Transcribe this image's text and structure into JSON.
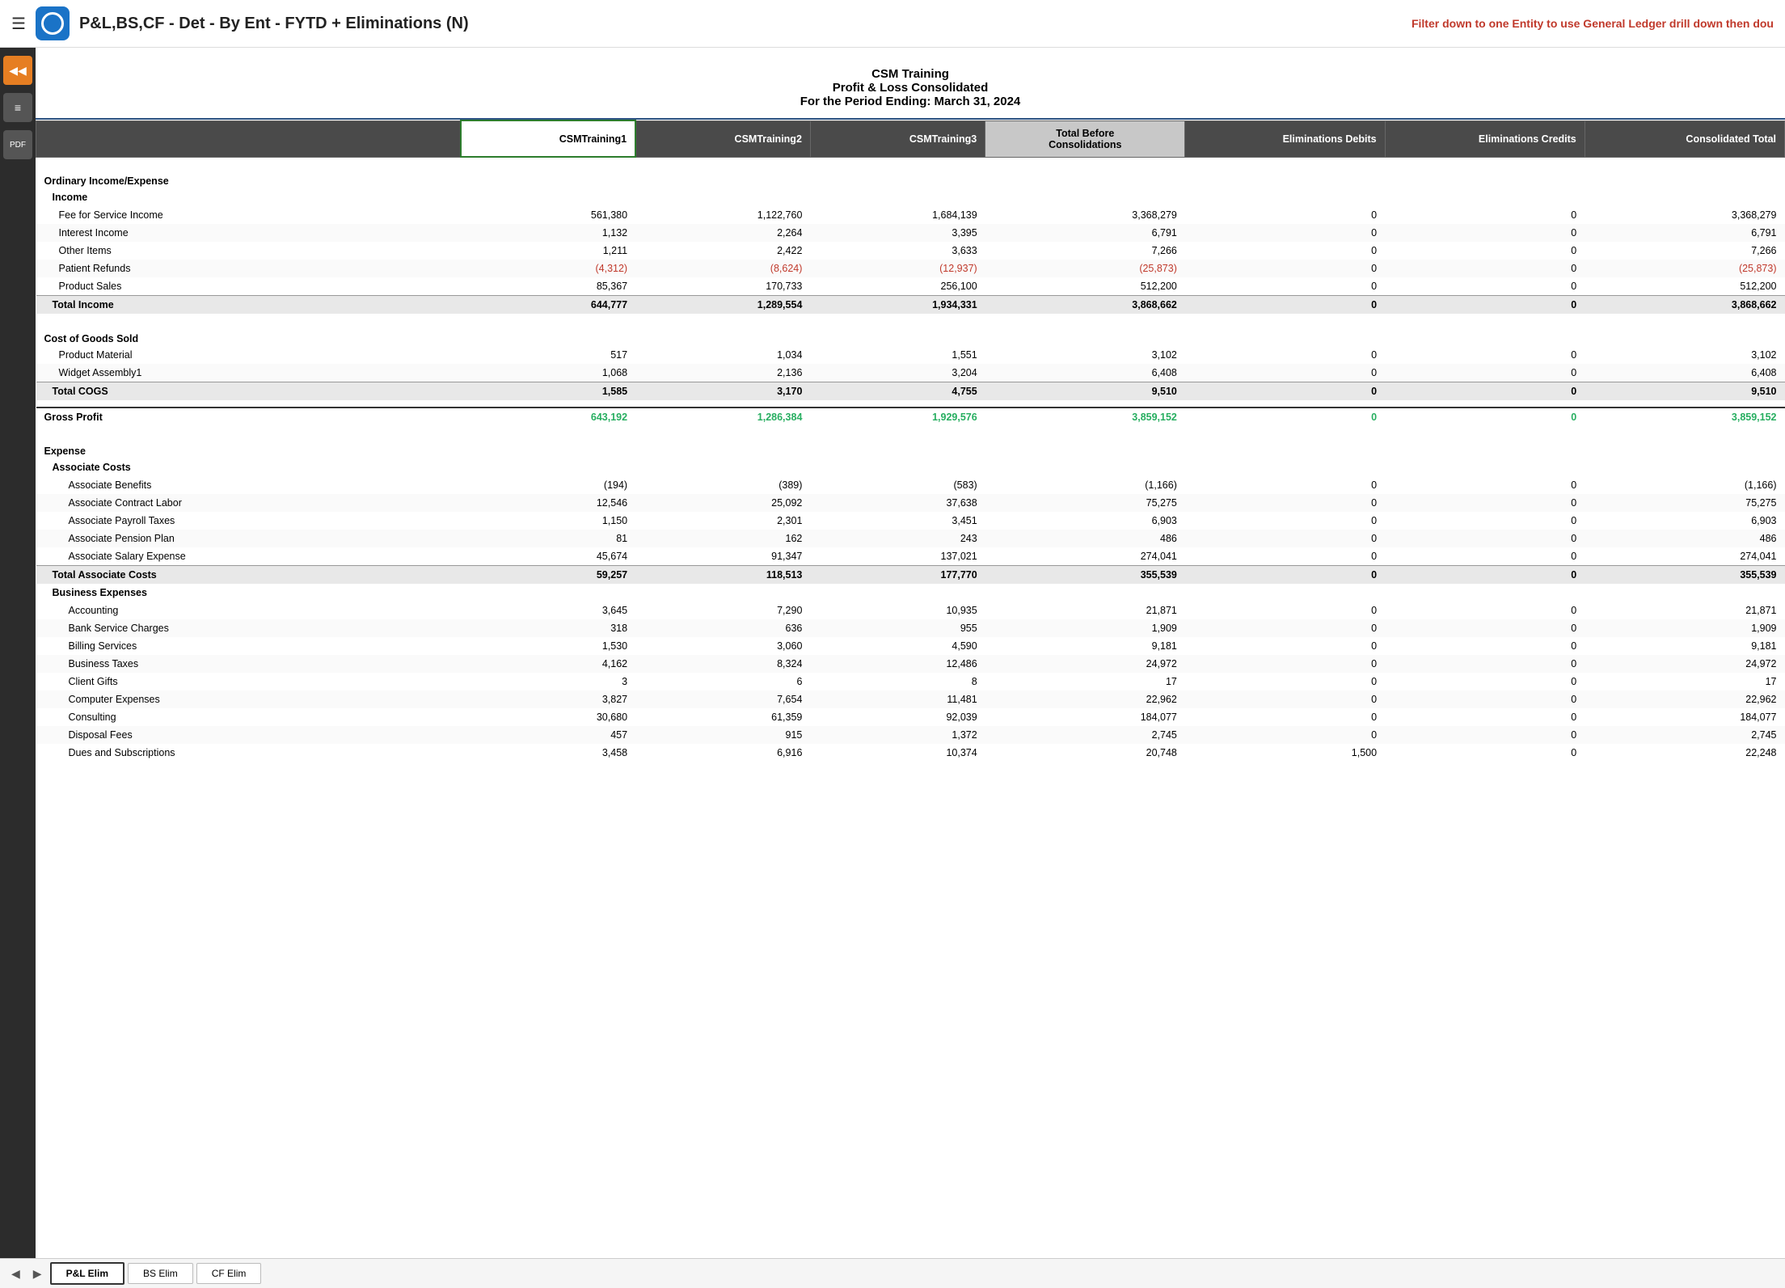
{
  "header": {
    "title": "P&L,BS,CF - Det - By Ent - FYTD + Eliminations (N)",
    "filter_text": "Filter down to one ",
    "filter_entity": "Entity",
    "filter_suffix": " to use General Ledger drill down then dou"
  },
  "report": {
    "company": "CSM Training",
    "title": "Profit & Loss Consolidated",
    "period": "For the Period Ending: March 31, 2024"
  },
  "columns": {
    "col1": "CSMTraining1",
    "col2": "CSMTraining2",
    "col3": "CSMTraining3",
    "col4": "Total Before\nConsolidations",
    "col5": "Eliminations Debits",
    "col6": "Eliminations Credits",
    "col7": "Consolidated Total"
  },
  "sections": {
    "ordinary": "Ordinary Income/Expense",
    "income": "Income",
    "income_rows": [
      {
        "label": "Fee for Service Income",
        "c1": "561,380",
        "c2": "1,122,760",
        "c3": "1,684,139",
        "c4": "3,368,279",
        "c5": "0",
        "c6": "0",
        "c7": "3,368,279",
        "color": "normal"
      },
      {
        "label": "Interest Income",
        "c1": "1,132",
        "c2": "2,264",
        "c3": "3,395",
        "c4": "6,791",
        "c5": "0",
        "c6": "0",
        "c7": "6,791",
        "color": "normal"
      },
      {
        "label": "Other Items",
        "c1": "1,211",
        "c2": "2,422",
        "c3": "3,633",
        "c4": "7,266",
        "c5": "0",
        "c6": "0",
        "c7": "7,266",
        "color": "normal"
      },
      {
        "label": "Patient Refunds",
        "c1": "(4,312)",
        "c2": "(8,624)",
        "c3": "(12,937)",
        "c4": "(25,873)",
        "c5": "0",
        "c6": "0",
        "c7": "(25,873)",
        "color": "red"
      },
      {
        "label": "Product Sales",
        "c1": "85,367",
        "c2": "170,733",
        "c3": "256,100",
        "c4": "512,200",
        "c5": "0",
        "c6": "0",
        "c7": "512,200",
        "color": "normal"
      }
    ],
    "total_income": {
      "label": "Total Income",
      "c1": "644,777",
      "c2": "1,289,554",
      "c3": "1,934,331",
      "c4": "3,868,662",
      "c5": "0",
      "c6": "0",
      "c7": "3,868,662"
    },
    "cogs": "Cost of Goods Sold",
    "cogs_rows": [
      {
        "label": "Product Material",
        "c1": "517",
        "c2": "1,034",
        "c3": "1,551",
        "c4": "3,102",
        "c5": "0",
        "c6": "0",
        "c7": "3,102"
      },
      {
        "label": "Widget Assembly1",
        "c1": "1,068",
        "c2": "2,136",
        "c3": "3,204",
        "c4": "6,408",
        "c5": "0",
        "c6": "0",
        "c7": "6,408"
      }
    ],
    "total_cogs": {
      "label": "Total COGS",
      "c1": "1,585",
      "c2": "3,170",
      "c3": "4,755",
      "c4": "9,510",
      "c5": "0",
      "c6": "0",
      "c7": "9,510"
    },
    "gross_profit": {
      "label": "Gross Profit",
      "c1": "643,192",
      "c2": "1,286,384",
      "c3": "1,929,576",
      "c4": "3,859,152",
      "c5": "0",
      "c6": "0",
      "c7": "3,859,152"
    },
    "expense": "Expense",
    "associate_costs": "Associate Costs",
    "associate_rows": [
      {
        "label": "Associate Benefits",
        "c1": "(194)",
        "c2": "(389)",
        "c3": "(583)",
        "c4": "(1,166)",
        "c5": "0",
        "c6": "0",
        "c7": "(1,166)",
        "color": "normal"
      },
      {
        "label": "Associate Contract Labor",
        "c1": "12,546",
        "c2": "25,092",
        "c3": "37,638",
        "c4": "75,275",
        "c5": "0",
        "c6": "0",
        "c7": "75,275",
        "color": "normal"
      },
      {
        "label": "Associate Payroll Taxes",
        "c1": "1,150",
        "c2": "2,301",
        "c3": "3,451",
        "c4": "6,903",
        "c5": "0",
        "c6": "0",
        "c7": "6,903",
        "color": "normal"
      },
      {
        "label": "Associate Pension Plan",
        "c1": "81",
        "c2": "162",
        "c3": "243",
        "c4": "486",
        "c5": "0",
        "c6": "0",
        "c7": "486",
        "color": "normal"
      },
      {
        "label": "Associate Salary Expense",
        "c1": "45,674",
        "c2": "91,347",
        "c3": "137,021",
        "c4": "274,041",
        "c5": "0",
        "c6": "0",
        "c7": "274,041",
        "color": "normal"
      }
    ],
    "total_associate": {
      "label": "Total Associate Costs",
      "c1": "59,257",
      "c2": "118,513",
      "c3": "177,770",
      "c4": "355,539",
      "c5": "0",
      "c6": "0",
      "c7": "355,539"
    },
    "business_expenses": "Business Expenses",
    "business_rows": [
      {
        "label": "Accounting",
        "c1": "3,645",
        "c2": "7,290",
        "c3": "10,935",
        "c4": "21,871",
        "c5": "0",
        "c6": "0",
        "c7": "21,871"
      },
      {
        "label": "Bank Service Charges",
        "c1": "318",
        "c2": "636",
        "c3": "955",
        "c4": "1,909",
        "c5": "0",
        "c6": "0",
        "c7": "1,909"
      },
      {
        "label": "Billing Services",
        "c1": "1,530",
        "c2": "3,060",
        "c3": "4,590",
        "c4": "9,181",
        "c5": "0",
        "c6": "0",
        "c7": "9,181"
      },
      {
        "label": "Business Taxes",
        "c1": "4,162",
        "c2": "8,324",
        "c3": "12,486",
        "c4": "24,972",
        "c5": "0",
        "c6": "0",
        "c7": "24,972"
      },
      {
        "label": "Client Gifts",
        "c1": "3",
        "c2": "6",
        "c3": "8",
        "c4": "17",
        "c5": "0",
        "c6": "0",
        "c7": "17"
      },
      {
        "label": "Computer Expenses",
        "c1": "3,827",
        "c2": "7,654",
        "c3": "11,481",
        "c4": "22,962",
        "c5": "0",
        "c6": "0",
        "c7": "22,962"
      },
      {
        "label": "Consulting",
        "c1": "30,680",
        "c2": "61,359",
        "c3": "92,039",
        "c4": "184,077",
        "c5": "0",
        "c6": "0",
        "c7": "184,077"
      },
      {
        "label": "Disposal Fees",
        "c1": "457",
        "c2": "915",
        "c3": "1,372",
        "c4": "2,745",
        "c5": "0",
        "c6": "0",
        "c7": "2,745"
      },
      {
        "label": "Dues and Subscriptions",
        "c1": "3,458",
        "c2": "6,916",
        "c3": "10,374",
        "c4": "20,748",
        "c5": "1,500",
        "c6": "0",
        "c7": "22,248"
      }
    ]
  },
  "tabs": {
    "items": [
      "P&L Elim",
      "BS Elim",
      "CF Elim"
    ],
    "active": "P&L Elim"
  },
  "sidebar": {
    "buttons": [
      "◀◀",
      "≡",
      "PDF"
    ]
  }
}
